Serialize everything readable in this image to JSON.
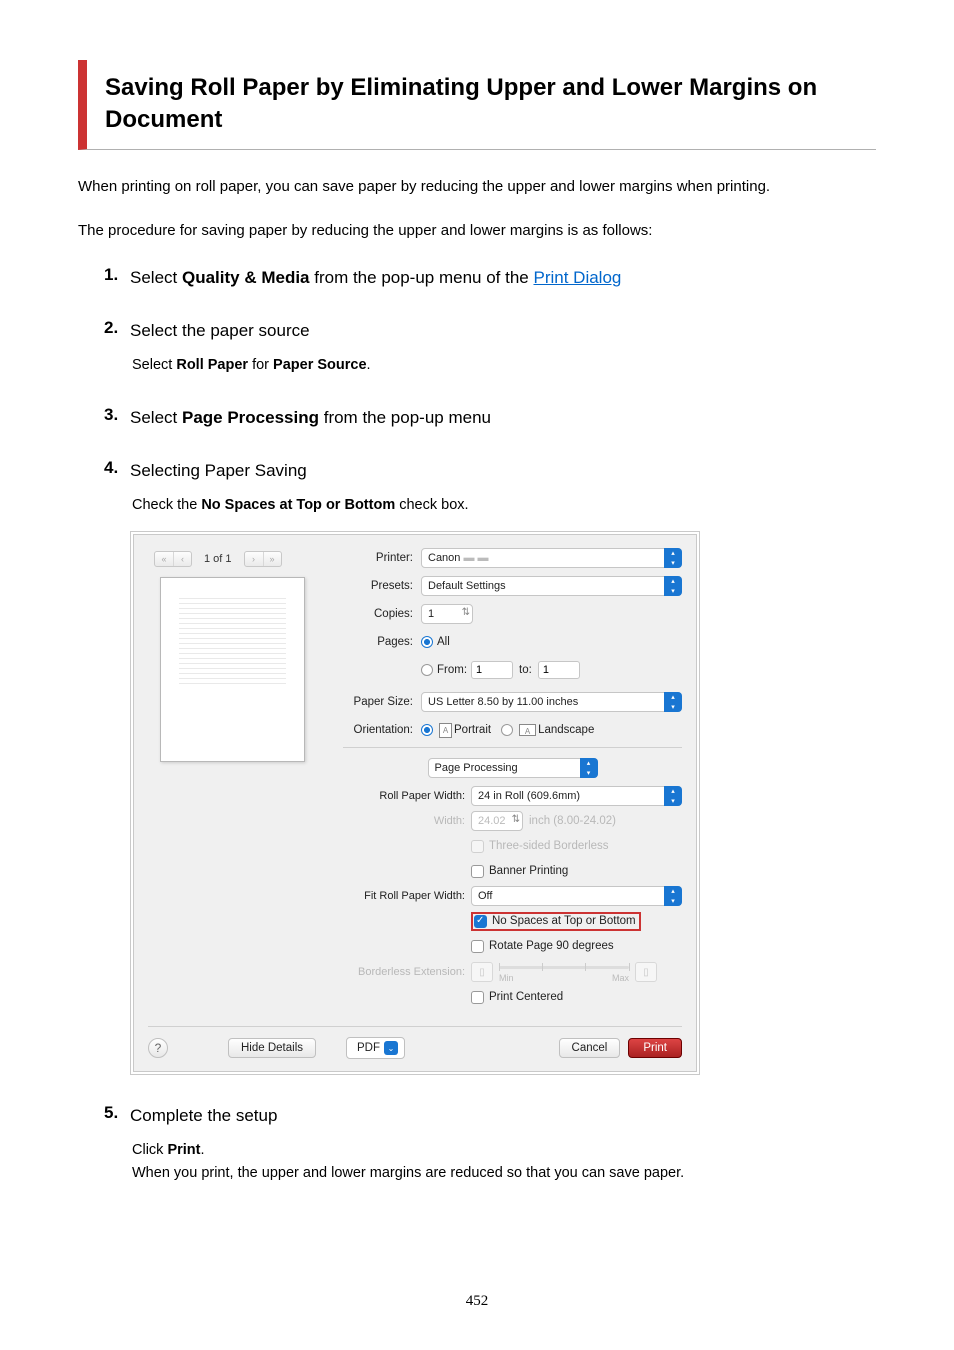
{
  "title": "Saving Roll Paper by Eliminating Upper and Lower Margins on Document",
  "intro1": "When printing on roll paper, you can save paper by reducing the upper and lower margins when printing.",
  "intro2": "The procedure for saving paper by reducing the upper and lower margins is as follows:",
  "steps": {
    "s1": {
      "pre": "Select ",
      "bold": "Quality & Media",
      "mid": " from the pop-up menu of the ",
      "link": "Print Dialog"
    },
    "s2": {
      "title": "Select the paper source",
      "body_pre": "Select ",
      "body_b1": "Roll Paper",
      "body_mid": " for ",
      "body_b2": "Paper Source",
      "body_post": "."
    },
    "s3": {
      "pre": "Select ",
      "bold": "Page Processing",
      "post": " from the pop-up menu"
    },
    "s4": {
      "title": "Selecting Paper Saving",
      "body_pre": "Check the ",
      "body_bold": "No Spaces at Top or Bottom",
      "body_post": " check box."
    },
    "s5": {
      "title": "Complete the setup",
      "body_pre": "Click ",
      "body_bold": "Print",
      "body_post": ".",
      "body_line2": "When you print, the upper and lower margins are reduced so that you can save paper."
    }
  },
  "dialog": {
    "page_counter": "1 of 1",
    "labels": {
      "printer": "Printer:",
      "presets": "Presets:",
      "copies": "Copies:",
      "pages": "Pages:",
      "from": "From:",
      "to": "to:",
      "paper_size": "Paper Size:",
      "orientation": "Orientation:",
      "roll_paper_width": "Roll Paper Width:",
      "width": "Width:",
      "fit_roll": "Fit Roll Paper Width:",
      "borderless_ext": "Borderless Extension:"
    },
    "values": {
      "printer": "Canon",
      "presets": "Default Settings",
      "copies": "1",
      "pages_all": "All",
      "from": "1",
      "to": "1",
      "paper_size": "US Letter 8.50 by 11.00 inches",
      "portrait": "Portrait",
      "landscape": "Landscape",
      "section": "Page Processing",
      "roll_paper_width": "24 in Roll (609.6mm)",
      "width_val": "24.02",
      "width_unit": "inch (8.00-24.02)",
      "three_sided": "Three-sided Borderless",
      "banner": "Banner Printing",
      "fit_roll": "Off",
      "no_spaces": "No Spaces at Top or Bottom",
      "rotate90": "Rotate Page 90 degrees",
      "print_centered": "Print Centered",
      "slider_min": "Min",
      "slider_max": "Max"
    },
    "buttons": {
      "hide_details": "Hide Details",
      "pdf": "PDF",
      "cancel": "Cancel",
      "print": "Print",
      "help": "?"
    }
  },
  "page_number": "452"
}
